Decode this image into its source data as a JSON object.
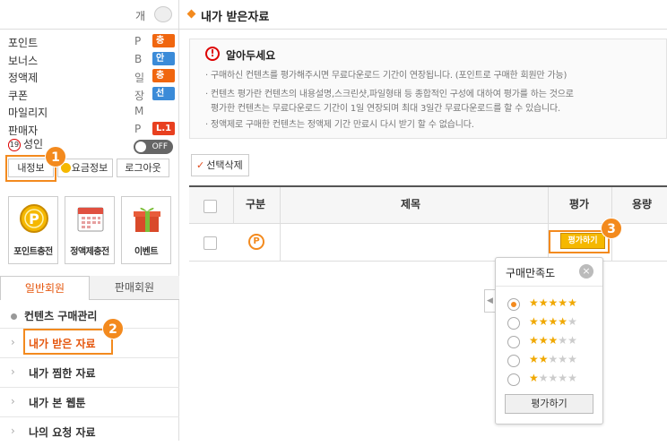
{
  "sidebar": {
    "top_unit": "개",
    "stats": [
      {
        "label": "포인트",
        "unit": "P",
        "badge": "충전",
        "badge_color": "#f0660f"
      },
      {
        "label": "보너스",
        "unit": "B",
        "badge": "안내",
        "badge_color": "#3b8bd8"
      },
      {
        "label": "정액제",
        "unit": "일",
        "badge": "충전",
        "badge_color": "#f0660f"
      },
      {
        "label": "쿠폰",
        "unit": "장",
        "badge": "선물",
        "badge_color": "#3b8bd8"
      },
      {
        "label": "마일리지",
        "unit": "M",
        "badge": "",
        "badge_color": ""
      },
      {
        "label": "판매자",
        "unit": "P",
        "badge": "L.1",
        "badge_color": "#e84020"
      }
    ],
    "age_icon": "19",
    "age_label": "성인",
    "toggle_label": "OFF",
    "buttons": {
      "my_info": "내정보",
      "fee_info": "요금정보",
      "logout": "로그아웃"
    },
    "quick": [
      {
        "label": "포인트충전",
        "icon": "coin-icon"
      },
      {
        "label": "정액제충전",
        "icon": "calendar-icon"
      },
      {
        "label": "이벤트",
        "icon": "gift-icon"
      }
    ],
    "member_tabs": {
      "general": "일반회원",
      "seller": "판매회원"
    },
    "menu_title": "컨텐츠 구매관리",
    "menu_items": [
      "내가 받은 자료",
      "내가 찜한 자료",
      "내가 본 웹툰",
      "나의 요청 자료"
    ],
    "chevron": "›"
  },
  "markers": [
    "1",
    "2",
    "3"
  ],
  "main": {
    "title": "내가 받은자료",
    "notice": {
      "icon": "!",
      "title": "알아두세요",
      "lines": [
        "· 구매하신 컨텐츠를 평가해주시면 무료다운로드 기간이 연장됩니다. (포인트로 구매한 회원만 가능)",
        "· 컨텐츠 평가란 컨텐츠의 내용설명,스크린샷,파일형태 등 종합적인 구성에 대하여 평가를 하는 것으로",
        "  평가한 컨텐츠는 무료다운로드 기간이 1일 연장되며 최대 3일간 무료다운로드를 할 수 있습니다.",
        "· 정액제로 구매한 컨텐츠는 정액제 기간 만료시 다시 받기 할 수 없습니다."
      ]
    },
    "delete_button": "선택삭제",
    "delete_check": "✓",
    "table": {
      "headers": [
        "구분",
        "제목",
        "평가",
        "용량"
      ],
      "row_icon": "P",
      "rate_button": "평가하기"
    },
    "popup": {
      "title": "구매만족도",
      "close": "×",
      "ratings": [
        5,
        4,
        3,
        2,
        1
      ],
      "selected": 5,
      "submit": "평가하기"
    },
    "side_arrow": "◀"
  }
}
